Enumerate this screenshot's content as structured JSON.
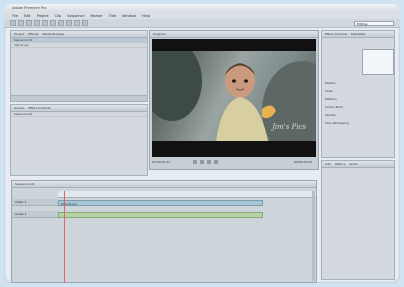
{
  "window": {
    "title": "Adobe Premiere Pro"
  },
  "menu": [
    "File",
    "Edit",
    "Project",
    "Clip",
    "Sequence",
    "Marker",
    "Title",
    "Window",
    "Help"
  ],
  "toolbar": {
    "workspace": "Editing"
  },
  "project_panel": {
    "tabs": [
      "Project",
      "Effects",
      "Media Browser"
    ],
    "items": [
      "Sequence 01",
      "Clip 01.avi"
    ],
    "columns": [
      "Name",
      "Label",
      "Media Start"
    ]
  },
  "source_panel": {
    "tabs": [
      "Source",
      "Effect Controls"
    ],
    "items": [
      "Sequence 01"
    ]
  },
  "viewer": {
    "tab": "Program",
    "timecode_left": "00:00:02:21",
    "timecode_right": "00:00:05:00",
    "watermark": "Jim's Pics"
  },
  "effects_panel": {
    "tabs": [
      "Effect Controls",
      "Metadata"
    ],
    "fields": [
      "Position",
      "Scale",
      "Rotation",
      "Anchor Point",
      "Opacity",
      "Time Remapping"
    ]
  },
  "info_panel": {
    "tabs": [
      "Info",
      "History",
      "Audio"
    ]
  },
  "timeline": {
    "tab": "Sequence 01",
    "tracks": [
      "Video 1",
      "Audio 1"
    ],
    "clip_name": "Clip 01.avi"
  }
}
